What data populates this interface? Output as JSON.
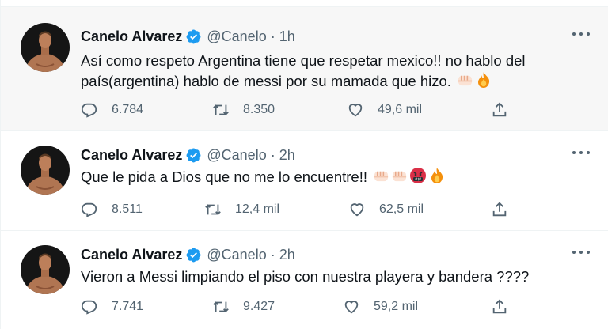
{
  "colors": {
    "verified": "#1d9bf0",
    "secondary_text": "#536471",
    "highlight_bg": "#f7f7f7"
  },
  "icons": [
    "avatar-photo",
    "verified-badge-icon",
    "more-icon",
    "reply-icon",
    "retweet-icon",
    "like-icon",
    "share-icon",
    "fist-emoji",
    "fire-emoji",
    "cursing-face-emoji"
  ],
  "tweets": [
    {
      "name": "Canelo Alvarez",
      "handle": "@Canelo",
      "separator": "·",
      "time": "1h",
      "text": "Así como respeto Argentina tiene que respetar mexico!! no hablo del país(argentina) hablo de messi por su mamada que hizo.",
      "emojis": [
        "fist",
        "fire"
      ],
      "replies": "6.784",
      "retweets": "8.350",
      "likes": "49,6 mil"
    },
    {
      "name": "Canelo Alvarez",
      "handle": "@Canelo",
      "separator": "·",
      "time": "2h",
      "text": "Que le pida a Dios que no me lo encuentre!!",
      "emojis": [
        "fist",
        "fist",
        "cursing-face",
        "fire"
      ],
      "replies": "8.511",
      "retweets": "12,4 mil",
      "likes": "62,5 mil"
    },
    {
      "name": "Canelo Alvarez",
      "handle": "@Canelo",
      "separator": "·",
      "time": "2h",
      "text": "Vieron a Messi limpiando el piso con nuestra playera y bandera ????",
      "emojis": [],
      "replies": "7.741",
      "retweets": "9.427",
      "likes": "59,2 mil"
    }
  ]
}
